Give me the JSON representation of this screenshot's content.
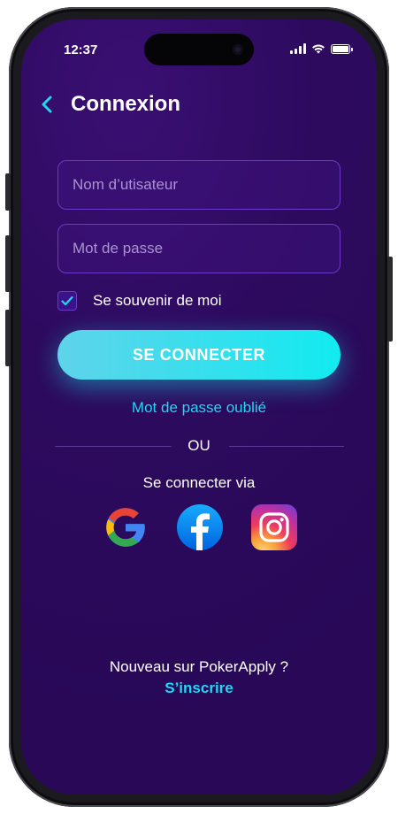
{
  "status_bar": {
    "time": "12:37"
  },
  "header": {
    "title": "Connexion"
  },
  "form": {
    "username_placeholder": "Nom d’utisateur",
    "password_placeholder": "Mot de passe",
    "remember_label": "Se souvenir de moi",
    "remember_checked": true,
    "submit_label": "SE CONNECTER"
  },
  "links": {
    "forgot_password": "Mot de passe oublié",
    "divider": "OU",
    "social_prompt": "Se connecter via",
    "new_user": "Nouveau sur PokerApply ?",
    "signup": "S’inscrire"
  },
  "social_icons": [
    "google-icon",
    "facebook-icon",
    "instagram-icon"
  ],
  "colors": {
    "accent": "#21d7f2",
    "background": "#2d0a5e",
    "button_gradient_start": "#5fd3ea",
    "button_gradient_end": "#12eaf0"
  }
}
